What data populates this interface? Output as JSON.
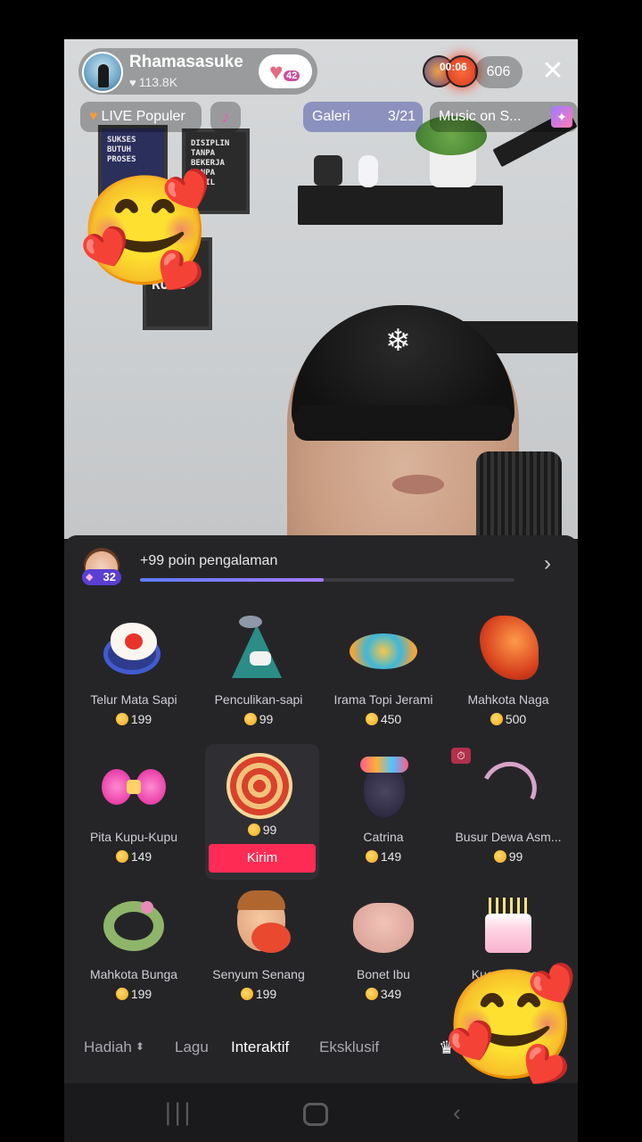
{
  "host": {
    "name": "Rhamasasuke",
    "likes": "113.8K",
    "fanclub_level": "42"
  },
  "top_right": {
    "timer": "00:06",
    "viewer_count": "606",
    "close_icon": "close-icon"
  },
  "chips": {
    "live_popular": "LIVE Populer",
    "galeri_label": "Galeri",
    "galeri_count": "3/21",
    "music_on": "Music on S..."
  },
  "reactions": {
    "emoji": "🥰"
  },
  "experience": {
    "level": "32",
    "text": "+99 poin pengalaman",
    "progress": 0.49
  },
  "gifts": [
    {
      "name": "Telur Mata Sapi",
      "price": "199"
    },
    {
      "name": "Penculikan-sapi",
      "price": "99"
    },
    {
      "name": "Irama Topi Jerami",
      "price": "450"
    },
    {
      "name": "Mahkota Naga",
      "price": "500"
    },
    {
      "name": "Pita Kupu-Kupu",
      "price": "149"
    },
    {
      "name": "",
      "price": "99",
      "send_label": "Kirim"
    },
    {
      "name": "Catrina",
      "price": "149"
    },
    {
      "name": "Busur Dewa Asm...",
      "price": "99"
    },
    {
      "name": "Mahkota Bunga",
      "price": "199"
    },
    {
      "name": "Senyum Senang",
      "price": "199"
    },
    {
      "name": "Bonet Ibu",
      "price": "349"
    },
    {
      "name": "Kue Harapan",
      "price": ""
    }
  ],
  "tabs": {
    "hadiah": "Hadiah",
    "lagu": "Lagu",
    "interaktif": "Interaktif",
    "eksklusif": "Eksklusif"
  },
  "icons": {
    "heart": "♥",
    "sort": "⬍",
    "chevron": "›",
    "shop": "♛",
    "timer_badge": "⏱"
  },
  "colors": {
    "accent_red": "#fe2c55",
    "panel_bg": "#252528",
    "xp_fill": "#5d7bff"
  }
}
